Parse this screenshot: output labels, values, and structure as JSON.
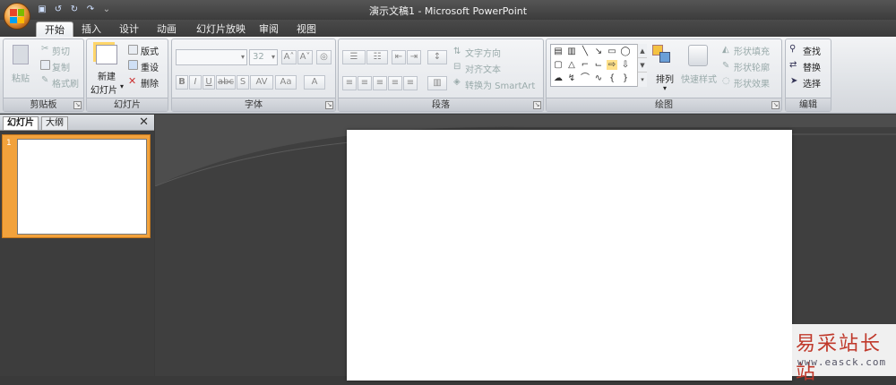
{
  "window": {
    "title": "演示文稿1 - Microsoft PowerPoint"
  },
  "qat": {
    "save_icon": "save-icon",
    "undo_icon": "undo-icon",
    "redo_icon": "redo-icon",
    "customize_icon": "customize-qat-icon"
  },
  "tabs": [
    {
      "label": "开始",
      "active": true
    },
    {
      "label": "插入"
    },
    {
      "label": "设计"
    },
    {
      "label": "动画"
    },
    {
      "label": "幻灯片放映"
    },
    {
      "label": "审阅"
    },
    {
      "label": "视图"
    }
  ],
  "clipboard": {
    "paste": "粘贴",
    "cut": "剪切",
    "copy": "复制",
    "format_painter": "格式刷",
    "group": "剪贴板"
  },
  "slides_group": {
    "new_slide_line1": "新建",
    "new_slide_line2": "幻灯片",
    "layout": "版式",
    "reset": "重设",
    "delete": "删除",
    "group": "幻灯片"
  },
  "font_group": {
    "font_size": "32",
    "group": "字体"
  },
  "paragraph_group": {
    "text_direction": "文字方向",
    "align_text": "对齐文本",
    "convert_smartart": "转换为 SmartArt",
    "group": "段落"
  },
  "drawing_group": {
    "arrange": "排列",
    "quick_styles": "快速样式",
    "shape_fill": "形状填充",
    "shape_outline": "形状轮廓",
    "shape_effects": "形状效果",
    "group": "绘图"
  },
  "editing_group": {
    "find": "查找",
    "replace": "替换",
    "select": "选择",
    "group": "编辑"
  },
  "left_panel": {
    "tab_slides": "幻灯片",
    "tab_outline": "大纲",
    "close": "✕",
    "thumb_number": "1"
  },
  "watermark": {
    "main": "易采站长站",
    "sub": "www.easck.com"
  },
  "colors": {
    "accent_orange": "#f2a23c",
    "dark_chrome": "#3a3a3a",
    "ribbon_light": "#e1e4e8"
  }
}
